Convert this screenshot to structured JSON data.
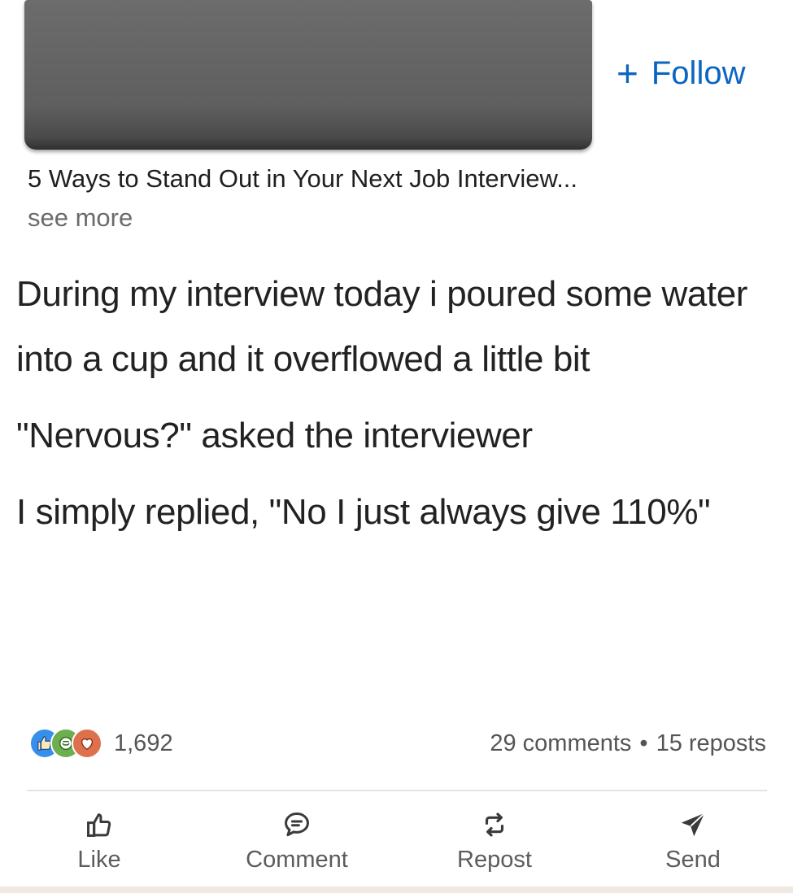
{
  "post": {
    "follow_label": "Follow",
    "follow_plus": "+",
    "headline": "5 Ways to Stand Out in Your Next Job Interview...",
    "see_more": "see more",
    "paragraphs": [
      "During my interview today i poured some water into a cup and it overflowed a little bit",
      "\"Nervous?\" asked the interviewer",
      "I simply replied, \"No I just always give 110%\""
    ]
  },
  "social": {
    "reaction_count": "1,692",
    "comments": "29 comments",
    "separator": "•",
    "reposts": "15 reposts",
    "reaction_icons": [
      "like-icon",
      "insightful-icon",
      "love-icon"
    ]
  },
  "actions": {
    "like": "Like",
    "comment": "Comment",
    "repost": "Repost",
    "send": "Send"
  },
  "colors": {
    "accent": "#0a66c2",
    "like": "#378fe9",
    "insightful": "#6dae4f",
    "love": "#df704d",
    "muted_text": "#555555"
  }
}
